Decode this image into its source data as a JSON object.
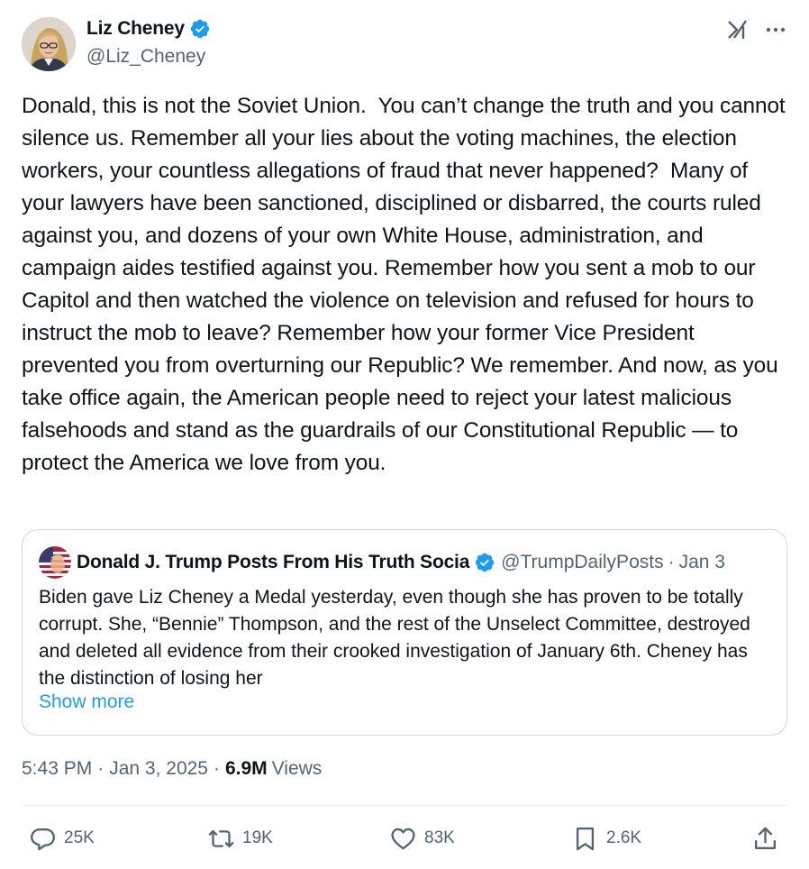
{
  "author": {
    "name": "Liz Cheney",
    "handle": "@Liz_Cheney",
    "verified": true,
    "avatar_icon": "avatar-photo"
  },
  "header_icons": [
    "grok-icon",
    "more-options-icon"
  ],
  "tweet_text": "Donald, this is not the Soviet Union.  You can’t change the truth and you cannot silence us. Remember all your lies about the voting machines, the election workers, your countless allegations of fraud that never happened?  Many of your lawyers have been sanctioned, disciplined or disbarred, the courts ruled against you, and dozens of your own White House, administration, and campaign aides testified against you. Remember how you sent a mob to our Capitol and then watched the violence on television and refused for hours to instruct the mob to leave? Remember how your former Vice President prevented you from overturning our Republic? We remember. And now, as you take office again, the American people need to reject your latest malicious falsehoods and stand as the guardrails of our Constitutional Republic — to protect the America we love from you.",
  "quote": {
    "name": "Donald J. Trump Posts From His Truth Socia",
    "handle": "@TrumpDailyPosts",
    "separator": "·",
    "date": "Jan 3",
    "verified": true,
    "text": "Biden gave Liz Cheney a Medal yesterday, even though she has proven to be totally corrupt. She, “Bennie” Thompson, and the rest of the Unselect Committee, destroyed and deleted all evidence from their crooked investigation of January 6th. Cheney has the distinction of losing her",
    "show_more": "Show more"
  },
  "meta": {
    "time": "5:43 PM",
    "separator": "·",
    "date": "Jan 3, 2025",
    "views_count": "6.9M",
    "views_label": "Views"
  },
  "actions": {
    "replies": "25K",
    "reposts": "19K",
    "likes": "83K",
    "bookmarks": "2.6K"
  },
  "colors": {
    "text_primary": "#0f1419",
    "text_secondary": "#536471",
    "accent_blue": "#1d9bf0",
    "border": "#cfd9de"
  }
}
